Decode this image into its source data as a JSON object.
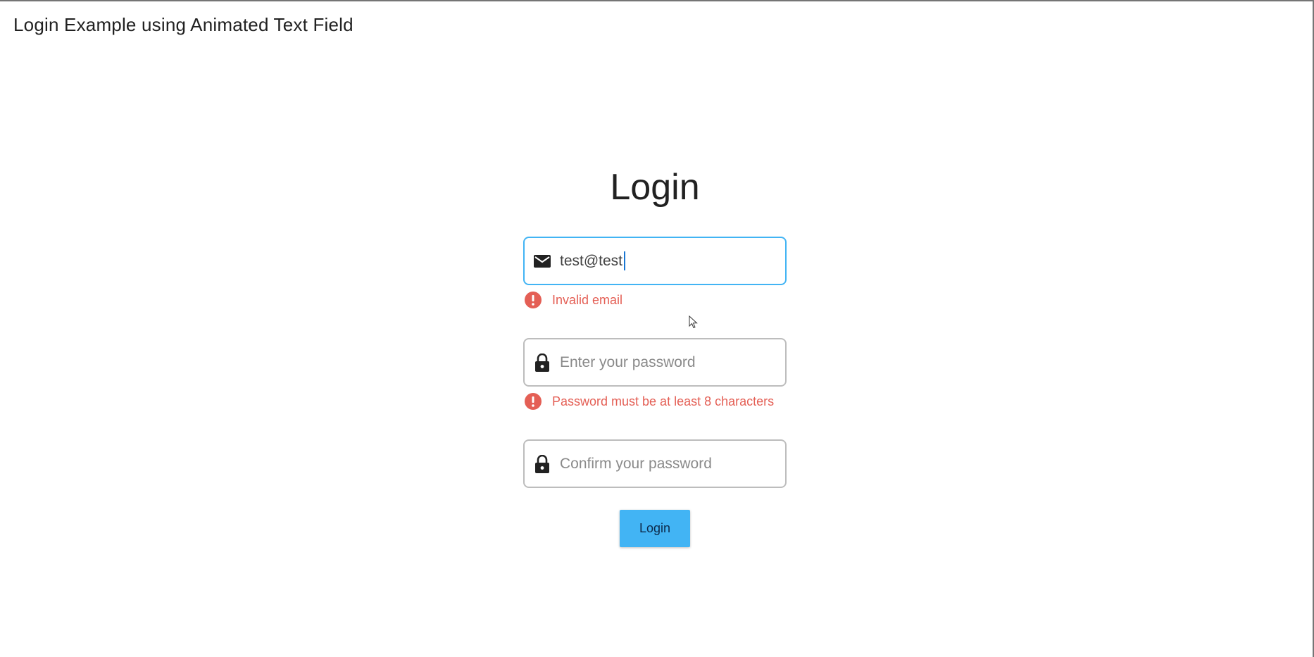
{
  "app_bar": {
    "title": "Login Example using Animated Text Field"
  },
  "form": {
    "heading": "Login",
    "email": {
      "value": "test@test",
      "icon": "mail-icon",
      "error": "Invalid email"
    },
    "password": {
      "placeholder": "Enter your password",
      "icon": "lock-icon",
      "error": "Password must be at least 8 characters"
    },
    "confirm_password": {
      "placeholder": "Confirm your password",
      "icon": "lock-icon"
    },
    "submit_label": "Login"
  },
  "colors": {
    "accent": "#42b4f4",
    "error": "#e45f55",
    "field_border": "#bdbdbd"
  }
}
